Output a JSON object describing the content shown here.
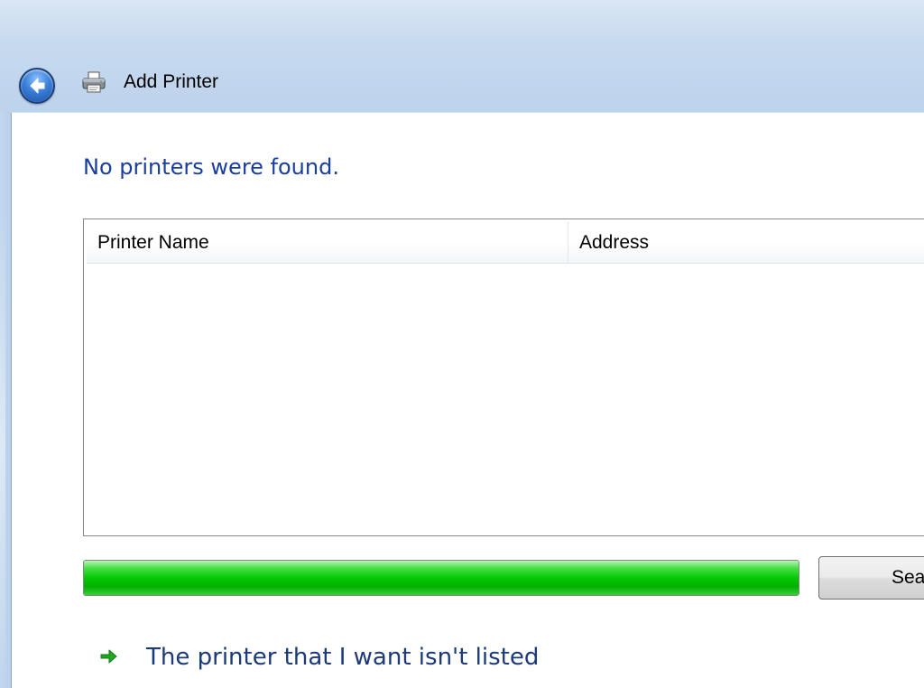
{
  "window": {
    "title": "Add Printer"
  },
  "icons": {
    "back": "back-arrow-icon",
    "printer": "printer-icon",
    "link_arrow": "green-arrow-icon"
  },
  "colors": {
    "heading": "#1a3e9c",
    "link": "#1c3a7a",
    "progress_fill": "#06c806",
    "frame": "#c6d9ee"
  },
  "main": {
    "heading": "No printers were found.",
    "list": {
      "columns": [
        {
          "label": "Printer Name"
        },
        {
          "label": "Address"
        }
      ],
      "rows": []
    },
    "progress": {
      "percent": 100
    },
    "search_button_label": "Search again",
    "link_label": "The printer that I want isn't listed"
  }
}
